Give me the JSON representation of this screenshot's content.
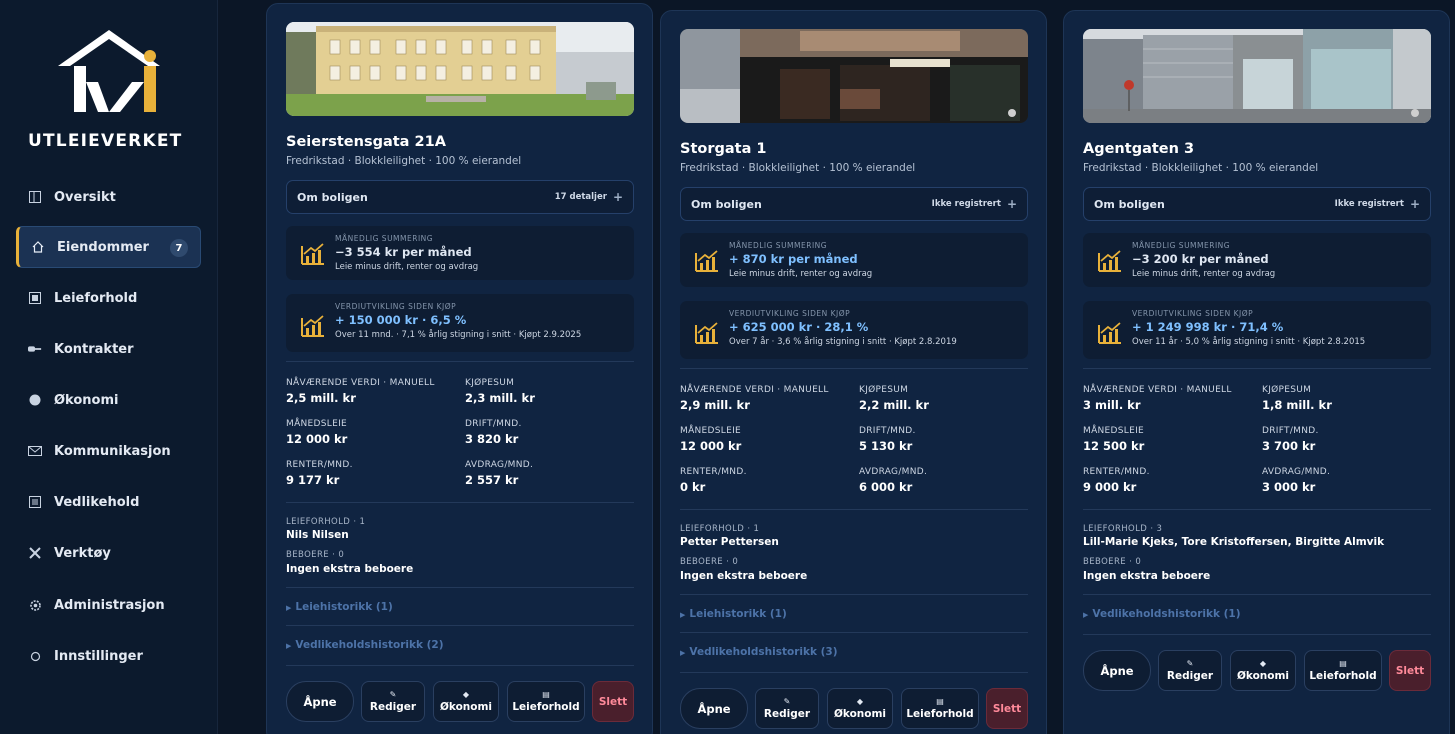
{
  "brand": {
    "name": "UTLEIEVERKET"
  },
  "colors": {
    "accent": "#e8b13a",
    "background": "#0b1626",
    "card": "#102441",
    "positive": "#7fc0ff",
    "danger": "#ff8a9a"
  },
  "nav": {
    "items": [
      {
        "label": "Oversikt",
        "icon": "layout-icon"
      },
      {
        "label": "Eiendommer",
        "icon": "home-icon",
        "badge": "7",
        "active": true
      },
      {
        "label": "Leieforhold",
        "icon": "square-icon"
      },
      {
        "label": "Kontrakter",
        "icon": "key-icon"
      },
      {
        "label": "Økonomi",
        "icon": "circle-icon"
      },
      {
        "label": "Kommunikasjon",
        "icon": "mail-icon"
      },
      {
        "label": "Vedlikehold",
        "icon": "list-icon"
      },
      {
        "label": "Verktøy",
        "icon": "tools-icon"
      },
      {
        "label": "Administrasjon",
        "icon": "gear-icon"
      },
      {
        "label": "Innstillinger",
        "icon": "settings-icon"
      }
    ]
  },
  "cards": [
    {
      "title": "Seierstensgata 21A",
      "subtitle": "Fredrikstad · Blokkleilighet · 100 % eierandel",
      "about": {
        "label": "Om boligen",
        "right": "17 detaljer"
      },
      "monthly": {
        "label": "MÅNEDLIG SUMMERING",
        "value": "−3 554 kr per måned",
        "note": "Leie minus drift, renter og avdrag"
      },
      "growth": {
        "label": "VERDIUTVIKLING SIDEN KJØP",
        "value": "+ 150 000 kr · 6,5 %",
        "note": "Over 11 mnd. · 7,1 % årlig stigning i snitt · Kjøpt 2.9.2025"
      },
      "metrics": {
        "current_value_label": "NÅVÆRENDE VERDI · MANUELL",
        "current_value": "2,5 mill. kr",
        "purchase_label": "KJØPESUM",
        "purchase": "2,3 mill. kr",
        "rent_label": "MÅNEDSLEIE",
        "rent": "12 000 kr",
        "ops_label": "DRIFT/MND.",
        "ops": "3 820 kr",
        "interest_label": "RENTER/MND.",
        "interest": "9 177 kr",
        "install_label": "AVDRAG/MND.",
        "install": "2 557 kr"
      },
      "tenancy": {
        "label": "LEIEFORHOLD · 1",
        "value": "Nils Nilsen"
      },
      "residents": {
        "label": "BEBOERE · 0",
        "value": "Ingen ekstra beboere"
      },
      "histories": [
        "Leiehistorikk (1)",
        "Vedlikeholdshistorikk (2)"
      ],
      "buttons": {
        "open": "Åpne",
        "edit": "Rediger",
        "economy": "Økonomi",
        "tenancy": "Leieforhold",
        "delete": "Slett"
      }
    },
    {
      "title": "Storgata 1",
      "subtitle": "Fredrikstad · Blokkleilighet · 100 % eierandel",
      "about": {
        "label": "Om boligen",
        "right": "Ikke registrert"
      },
      "monthly": {
        "label": "MÅNEDLIG SUMMERING",
        "value": "+ 870 kr per måned",
        "note": "Leie minus drift, renter og avdrag"
      },
      "growth": {
        "label": "VERDIUTVIKLING SIDEN KJØP",
        "value": "+ 625 000 kr · 28,1 %",
        "note": "Over 7 år · 3,6 % årlig stigning i snitt · Kjøpt 2.8.2019"
      },
      "metrics": {
        "current_value_label": "NÅVÆRENDE VERDI · MANUELL",
        "current_value": "2,9 mill. kr",
        "purchase_label": "KJØPESUM",
        "purchase": "2,2 mill. kr",
        "rent_label": "MÅNEDSLEIE",
        "rent": "12 000 kr",
        "ops_label": "DRIFT/MND.",
        "ops": "5 130 kr",
        "interest_label": "RENTER/MND.",
        "interest": "0 kr",
        "install_label": "AVDRAG/MND.",
        "install": "6 000 kr"
      },
      "tenancy": {
        "label": "LEIEFORHOLD · 1",
        "value": "Petter Pettersen"
      },
      "residents": {
        "label": "BEBOERE · 0",
        "value": "Ingen ekstra beboere"
      },
      "histories": [
        "Leiehistorikk (1)",
        "Vedlikeholdshistorikk (3)"
      ],
      "buttons": {
        "open": "Åpne",
        "edit": "Rediger",
        "economy": "Økonomi",
        "tenancy": "Leieforhold",
        "delete": "Slett"
      }
    },
    {
      "title": "Agentgaten 3",
      "subtitle": "Fredrikstad · Blokkleilighet · 100 % eierandel",
      "about": {
        "label": "Om boligen",
        "right": "Ikke registrert"
      },
      "monthly": {
        "label": "MÅNEDLIG SUMMERING",
        "value": "−3 200 kr per måned",
        "note": "Leie minus drift, renter og avdrag"
      },
      "growth": {
        "label": "VERDIUTVIKLING SIDEN KJØP",
        "value": "+ 1 249 998 kr · 71,4 %",
        "note": "Over 11 år · 5,0 % årlig stigning i snitt · Kjøpt 2.8.2015"
      },
      "metrics": {
        "current_value_label": "NÅVÆRENDE VERDI · MANUELL",
        "current_value": "3 mill. kr",
        "purchase_label": "KJØPESUM",
        "purchase": "1,8 mill. kr",
        "rent_label": "MÅNEDSLEIE",
        "rent": "12 500 kr",
        "ops_label": "DRIFT/MND.",
        "ops": "3 700 kr",
        "interest_label": "RENTER/MND.",
        "interest": "9 000 kr",
        "install_label": "AVDRAG/MND.",
        "install": "3 000 kr"
      },
      "tenancy": {
        "label": "LEIEFORHOLD · 3",
        "value": "Lill-Marie Kjeks, Tore Kristoffersen, Birgitte Almvik"
      },
      "residents": {
        "label": "BEBOERE · 0",
        "value": "Ingen ekstra beboere"
      },
      "histories": [
        "Vedlikeholdshistorikk (1)"
      ],
      "buttons": {
        "open": "Åpne",
        "edit": "Rediger",
        "economy": "Økonomi",
        "tenancy": "Leieforhold",
        "delete": "Slett"
      }
    }
  ]
}
